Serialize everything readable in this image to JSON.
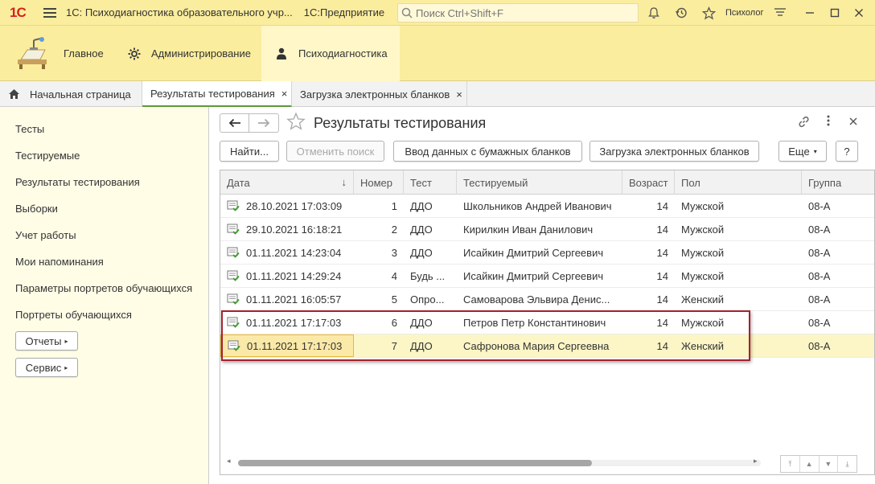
{
  "titlebar": {
    "logo": "1С",
    "app_title": "1С: Психодиагностика образовательного учр...",
    "platform": "1С:Предприятие",
    "search_placeholder": "Поиск Ctrl+Shift+F",
    "user": "Психолог"
  },
  "sections": [
    {
      "label": "Главное",
      "icon": "desk-icon"
    },
    {
      "label": "Администрирование",
      "icon": "gear-icon"
    },
    {
      "label": "Психодиагностика",
      "icon": "person-icon"
    }
  ],
  "tabs": [
    {
      "label": "Начальная страница",
      "icon": "home-icon"
    },
    {
      "label": "Результаты тестирования",
      "close": "×"
    },
    {
      "label": "Загрузка электронных бланков",
      "close": "×"
    }
  ],
  "leftnav": {
    "items": [
      "Тесты",
      "Тестируемые",
      "Результаты тестирования",
      "Выборки",
      "Учет работы",
      "Мои напоминания",
      "Параметры портретов обучающихся",
      "Портреты обучающихся"
    ],
    "buttons": [
      "Отчеты",
      "Сервис"
    ]
  },
  "form": {
    "title": "Результаты тестирования",
    "buttons": {
      "find": "Найти...",
      "cancel_search": "Отменить поиск",
      "paper_input": "Ввод данных с бумажных бланков",
      "load_electronic": "Загрузка электронных бланков",
      "more": "Еще",
      "help": "?"
    }
  },
  "table": {
    "columns": [
      "Дата",
      "Номер",
      "Тест",
      "Тестируемый",
      "Возраст",
      "Пол",
      "Группа"
    ],
    "rows": [
      {
        "date": "28.10.2021 17:03:09",
        "number": "1",
        "test": "ДДО",
        "person": "Школьников Андрей Иванович",
        "age": "14",
        "sex": "Мужской",
        "group": "08-А"
      },
      {
        "date": "29.10.2021 16:18:21",
        "number": "2",
        "test": "ДДО",
        "person": "Кирилкин Иван Данилович",
        "age": "14",
        "sex": "Мужской",
        "group": "08-А"
      },
      {
        "date": "01.11.2021 14:23:04",
        "number": "3",
        "test": "ДДО",
        "person": "Исайкин Дмитрий Сергеевич",
        "age": "14",
        "sex": "Мужской",
        "group": "08-А"
      },
      {
        "date": "01.11.2021 14:29:24",
        "number": "4",
        "test": "Будь ...",
        "person": "Исайкин Дмитрий Сергеевич",
        "age": "14",
        "sex": "Мужской",
        "group": "08-А"
      },
      {
        "date": "01.11.2021 16:05:57",
        "number": "5",
        "test": "Опро...",
        "person": "Самоварова Эльвира Денис...",
        "age": "14",
        "sex": "Женский",
        "group": "08-А"
      },
      {
        "date": "01.11.2021 17:17:03",
        "number": "6",
        "test": "ДДО",
        "person": "Петров Петр Константинович",
        "age": "14",
        "sex": "Мужской",
        "group": "08-А"
      },
      {
        "date": "01.11.2021 17:17:03",
        "number": "7",
        "test": "ДДО",
        "person": "Сафронова Мария Сергеевна",
        "age": "14",
        "sex": "Женский",
        "group": "08-А"
      }
    ],
    "selected_row": 6
  },
  "colors": {
    "titlebar_bg": "#fbed9e",
    "accent_red": "#d6211d",
    "highlight_border": "#a8202c",
    "selected_row": "#fcf5c6"
  }
}
